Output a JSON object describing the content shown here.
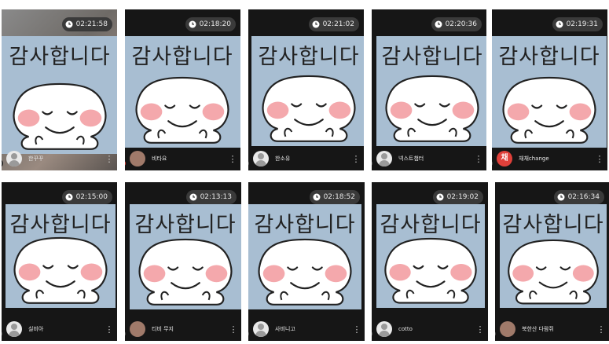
{
  "tiles": [
    {
      "timer": "02:21:58",
      "name": "한꾸꾸",
      "avatar": "default-person-icon",
      "camera": true
    },
    {
      "timer": "02:18:20",
      "name": "비타요",
      "avatar": "photo",
      "camera": false
    },
    {
      "timer": "02:21:02",
      "name": "한소유",
      "avatar": "default-person-icon",
      "camera": false
    },
    {
      "timer": "02:20:36",
      "name": "넥스트챕터",
      "avatar": "default-person-icon",
      "camera": false
    },
    {
      "timer": "02:19:31",
      "name": "채채change",
      "avatar": "red-initial",
      "avatar_text": "채",
      "camera": false
    },
    {
      "timer": "02:15:00",
      "name": "실비아",
      "avatar": "default-person-icon",
      "camera": false
    },
    {
      "timer": "02:13:13",
      "name": "티비 무지",
      "avatar": "photo",
      "camera": false
    },
    {
      "timer": "02:18:52",
      "name": "사비니고",
      "avatar": "default-person-icon",
      "camera": false
    },
    {
      "timer": "02:19:02",
      "name": "cotto",
      "avatar": "default-person-icon",
      "camera": false
    },
    {
      "timer": "02:16:34",
      "name": "북한산 다람쥐",
      "avatar": "photo",
      "camera": false
    }
  ],
  "card_text": "감사합니다",
  "colors": {
    "tile_bg": "#161616",
    "card_bg": "#a8bed2",
    "timer_bg": "#3a3a3a",
    "blush": "#f4a8ac"
  }
}
